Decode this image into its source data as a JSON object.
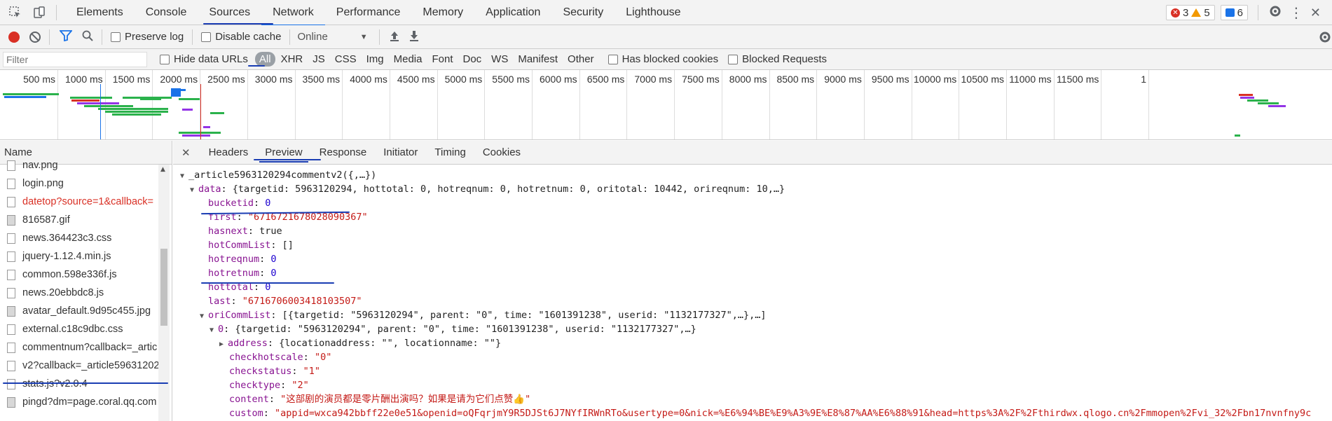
{
  "devtools_tabs": [
    "Elements",
    "Console",
    "Sources",
    "Network",
    "Performance",
    "Memory",
    "Application",
    "Security",
    "Lighthouse"
  ],
  "active_tab": "Network",
  "badges": {
    "errors": "3",
    "warnings": "5",
    "info": "6"
  },
  "toolbar": {
    "preserve_log": "Preserve log",
    "disable_cache": "Disable cache",
    "throttle": "Online"
  },
  "filter": {
    "placeholder": "Filter",
    "hide_data_urls": "Hide data URLs",
    "types": [
      "All",
      "XHR",
      "JS",
      "CSS",
      "Img",
      "Media",
      "Font",
      "Doc",
      "WS",
      "Manifest",
      "Other"
    ],
    "has_blocked_cookies": "Has blocked cookies",
    "blocked_requests": "Blocked Requests"
  },
  "timeline_ticks": [
    "500 ms",
    "1000 ms",
    "1500 ms",
    "2000 ms",
    "2500 ms",
    "3000 ms",
    "3500 ms",
    "4000 ms",
    "4500 ms",
    "5000 ms",
    "5500 ms",
    "6000 ms",
    "6500 ms",
    "7000 ms",
    "7500 ms",
    "8000 ms",
    "8500 ms",
    "9000 ms",
    "9500 ms",
    "10000 ms",
    "10500 ms",
    "11000 ms",
    "11500 ms",
    "1"
  ],
  "request_list": {
    "header": "Name",
    "items": [
      {
        "name": "nav.png",
        "kind": "doc",
        "error": false
      },
      {
        "name": "login.png",
        "kind": "doc",
        "error": false
      },
      {
        "name": "datetop?source=1&callback=",
        "kind": "doc",
        "error": true
      },
      {
        "name": "816587.gif",
        "kind": "img",
        "error": false
      },
      {
        "name": "news.364423c3.css",
        "kind": "doc",
        "error": false
      },
      {
        "name": "jquery-1.12.4.min.js",
        "kind": "doc",
        "error": false
      },
      {
        "name": "common.598e336f.js",
        "kind": "doc",
        "error": false
      },
      {
        "name": "news.20ebbdc8.js",
        "kind": "doc",
        "error": false
      },
      {
        "name": "avatar_default.9d95c455.jpg",
        "kind": "img",
        "error": false
      },
      {
        "name": "external.c18c9dbc.css",
        "kind": "doc",
        "error": false
      },
      {
        "name": "commentnum?callback=_artic",
        "kind": "doc",
        "error": false
      },
      {
        "name": "v2?callback=_article59631202",
        "kind": "doc",
        "error": false
      },
      {
        "name": "stats.js?v2.0.4",
        "kind": "doc",
        "error": false
      },
      {
        "name": "pingd?dm=page.coral.qq.com",
        "kind": "img",
        "error": false
      }
    ]
  },
  "detail_tabs": [
    "Headers",
    "Preview",
    "Response",
    "Initiator",
    "Timing",
    "Cookies"
  ],
  "active_detail_tab": "Preview",
  "preview": {
    "root": "_article5963120294commentv2({,…})",
    "data_summary": "{targetid: 5963120294, hottotal: 0, hotreqnum: 0, hotretnum: 0, oritotal: 10442, orireqnum: 10,…}",
    "fields": [
      {
        "key": "bucketid",
        "value": "0",
        "type": "num"
      },
      {
        "key": "first",
        "value": "\"6716721678028090367\"",
        "type": "str"
      },
      {
        "key": "hasnext",
        "value": "true",
        "type": "plain"
      },
      {
        "key": "hotCommList",
        "value": "[]",
        "type": "plain"
      },
      {
        "key": "hotreqnum",
        "value": "0",
        "type": "num"
      },
      {
        "key": "hotretnum",
        "value": "0",
        "type": "num"
      },
      {
        "key": "hottotal",
        "value": "0",
        "type": "num"
      },
      {
        "key": "last",
        "value": "\"6716706003418103507\"",
        "type": "str"
      }
    ],
    "oriCommList_summary": "[{targetid: \"5963120294\", parent: \"0\", time: \"1601391238\", userid: \"1132177327\",…},…]",
    "item0_summary": "{targetid: \"5963120294\", parent: \"0\", time: \"1601391238\", userid: \"1132177327\",…}",
    "address_summary": "{locationaddress: \"\", locationname: \"\"}",
    "item_fields": [
      {
        "key": "checkhotscale",
        "value": "\"0\""
      },
      {
        "key": "checkstatus",
        "value": "\"1\""
      },
      {
        "key": "checktype",
        "value": "\"2\""
      },
      {
        "key": "content",
        "value": "\"这部剧的演员都是零片酬出演吗？如果是请为它们点赞👍\""
      },
      {
        "key": "custom",
        "value": "\"appid=wxca942bbff22e0e51&openid=oQFqrjmY9R5DJSt6J7NYfIRWnRTo&usertype=0&nick=%E6%94%BE%E9%A3%9E%E8%87%AA%E6%88%91&head=https%3A%2F%2Fthirdwx.qlogo.cn%2Fmmopen%2Fvi_32%2Fbn17nvnfny9c"
      }
    ]
  }
}
